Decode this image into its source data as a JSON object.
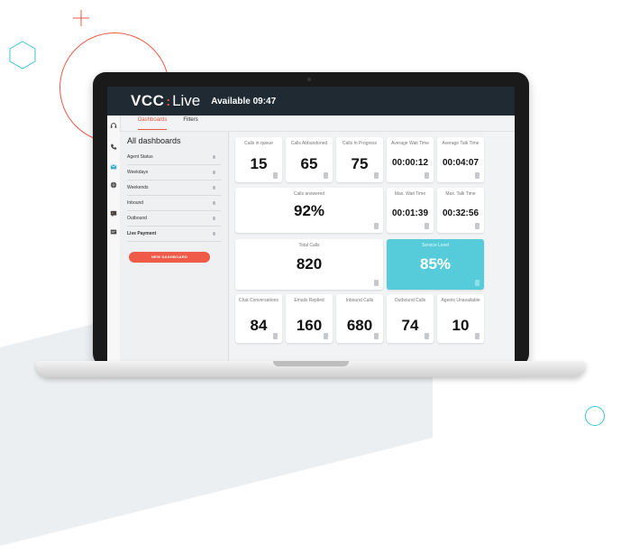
{
  "header": {
    "logo_main": "VCC",
    "logo_separator": ":",
    "logo_sub": "Live",
    "status": "Available 09:47"
  },
  "tabs": [
    {
      "label": "Dashboards",
      "active": true
    },
    {
      "label": "Filters",
      "active": false
    }
  ],
  "rail_icons": [
    "headset-icon",
    "phone-icon",
    "mail-icon",
    "globe-icon",
    "chat-icon",
    "message-icon"
  ],
  "sidebar": {
    "title": "All dashboards",
    "items": [
      {
        "label": "Agent Status"
      },
      {
        "label": "Weekdays"
      },
      {
        "label": "Weekends"
      },
      {
        "label": "Inbound"
      },
      {
        "label": "Outbound"
      },
      {
        "label": "Live Payment"
      }
    ],
    "new_button": "NEW DASHBOARD"
  },
  "tiles": {
    "calls_in_queue": {
      "label": "Calls in queue",
      "value": "15"
    },
    "calls_abandoned": {
      "label": "Calls Abbandoned",
      "value": "65"
    },
    "calls_in_progress": {
      "label": "Calls In Progress",
      "value": "75"
    },
    "avg_wait": {
      "label": "Average Wait Time",
      "value": "00:00:12"
    },
    "avg_talk": {
      "label": "Average Talk Time",
      "value": "00:04:07"
    },
    "calls_answered": {
      "label": "Calls answered",
      "value": "92%"
    },
    "max_wait": {
      "label": "Max. Wait Time",
      "value": "00:01:39"
    },
    "max_talk": {
      "label": "Max. Talk Time",
      "value": "00:32:56"
    },
    "total_calls": {
      "label": "Total Calls",
      "value": "820"
    },
    "service_level": {
      "label": "Service Level",
      "value": "85%"
    },
    "chat_conversations": {
      "label": "Chat Conversations",
      "value": "84"
    },
    "emails_replied": {
      "label": "Emails Replied",
      "value": "160"
    },
    "inbound_calls": {
      "label": "Inbound Calls",
      "value": "680"
    },
    "outbound_calls": {
      "label": "Outbound Calls",
      "value": "74"
    },
    "agents_unavailable": {
      "label": "Agents Unavailable",
      "value": "10"
    }
  },
  "colors": {
    "accent": "#f05a48",
    "header_bg": "#1f2a33",
    "service_level_tile": "#56cbd9"
  }
}
